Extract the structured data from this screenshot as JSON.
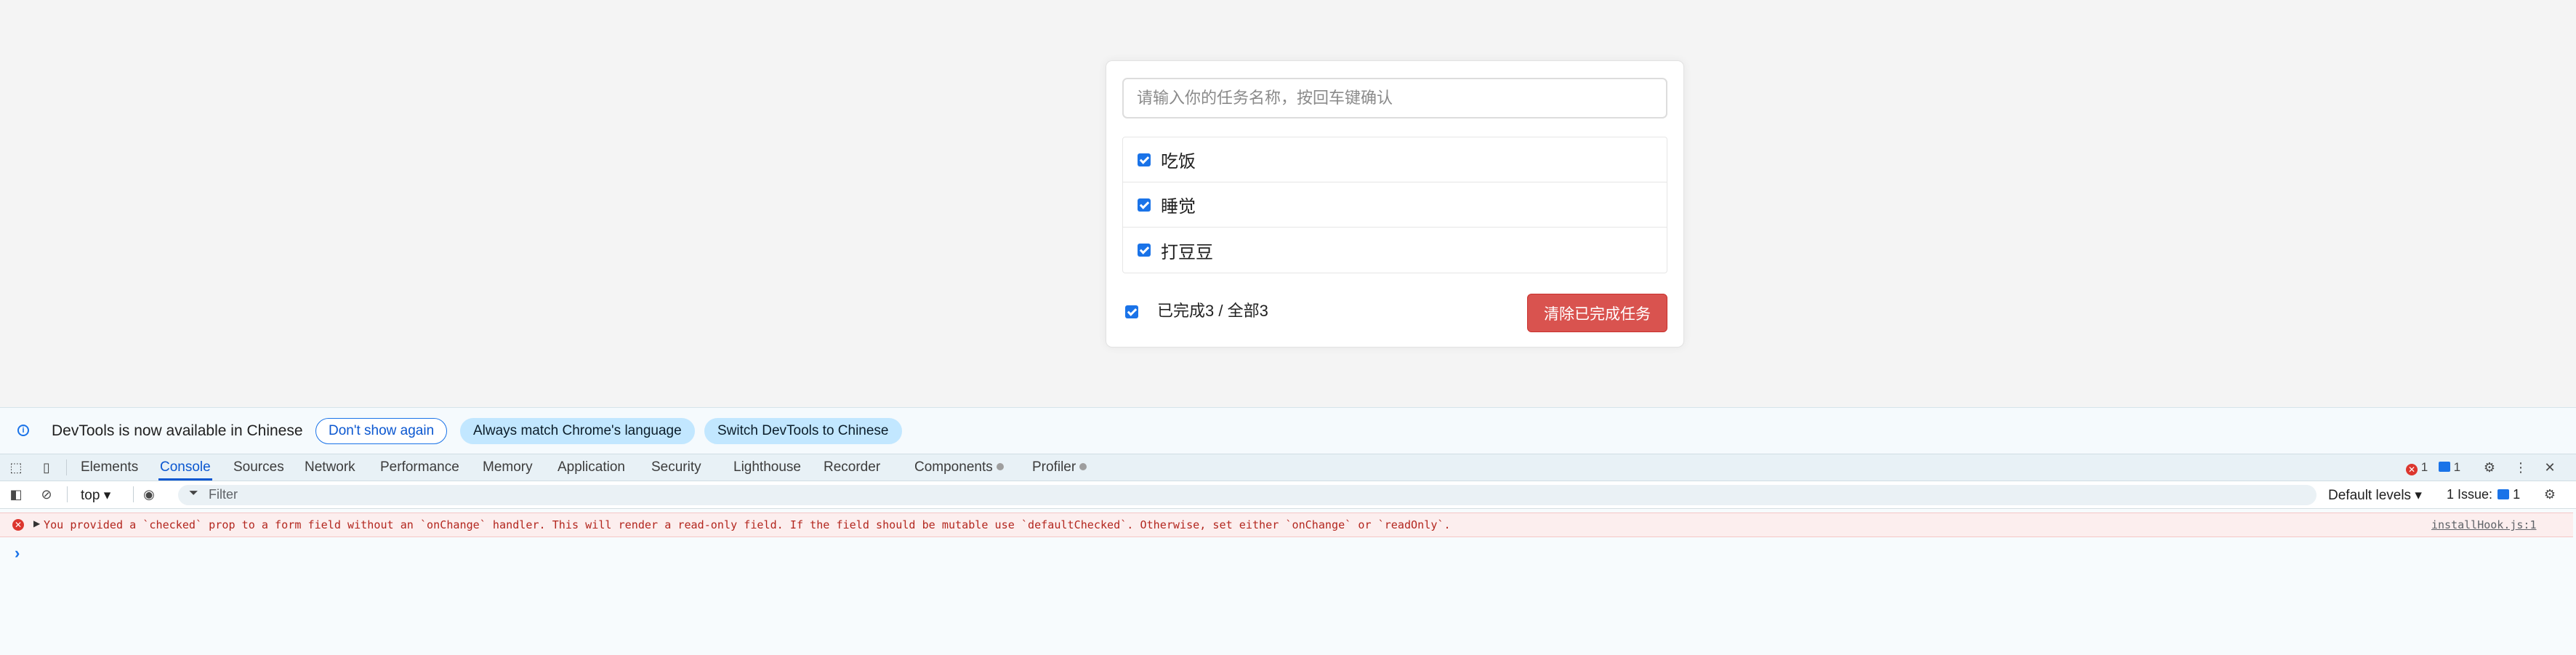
{
  "todo": {
    "input_placeholder": "请输入你的任务名称，按回车键确认",
    "items": [
      {
        "label": "吃饭",
        "checked": true
      },
      {
        "label": "睡觉",
        "checked": true
      },
      {
        "label": "打豆豆",
        "checked": true
      }
    ],
    "footer": {
      "all_checked": true,
      "summary": "已完成3 / 全部3",
      "clear_button": "清除已完成任务"
    },
    "accent_color": "#d9534f"
  },
  "devtools": {
    "infobar": {
      "message": "DevTools is now available in Chinese",
      "dont_show": "Don't show again",
      "always_match": "Always match Chrome's language",
      "switch": "Switch DevTools to Chinese"
    },
    "tabs": [
      "Elements",
      "Console",
      "Sources",
      "Network",
      "Performance",
      "Memory",
      "Application",
      "Security",
      "Lighthouse",
      "Recorder",
      "Components",
      "Profiler"
    ],
    "active_tab": "Console",
    "error_count": "1",
    "message_count": "1",
    "console_toolbar": {
      "context": "top",
      "filter_placeholder": "Filter",
      "levels": "Default levels",
      "issues_label": "1 Issue:",
      "issues_count": "1"
    },
    "console_error": {
      "message": "You provided a `checked` prop to a form field without an `onChange` handler. This will render a read-only field. If the field should be mutable use `defaultChecked`. Otherwise, set either `onChange` or `readOnly`.",
      "source": "installHook.js:1"
    },
    "prompt_symbol": "›"
  }
}
